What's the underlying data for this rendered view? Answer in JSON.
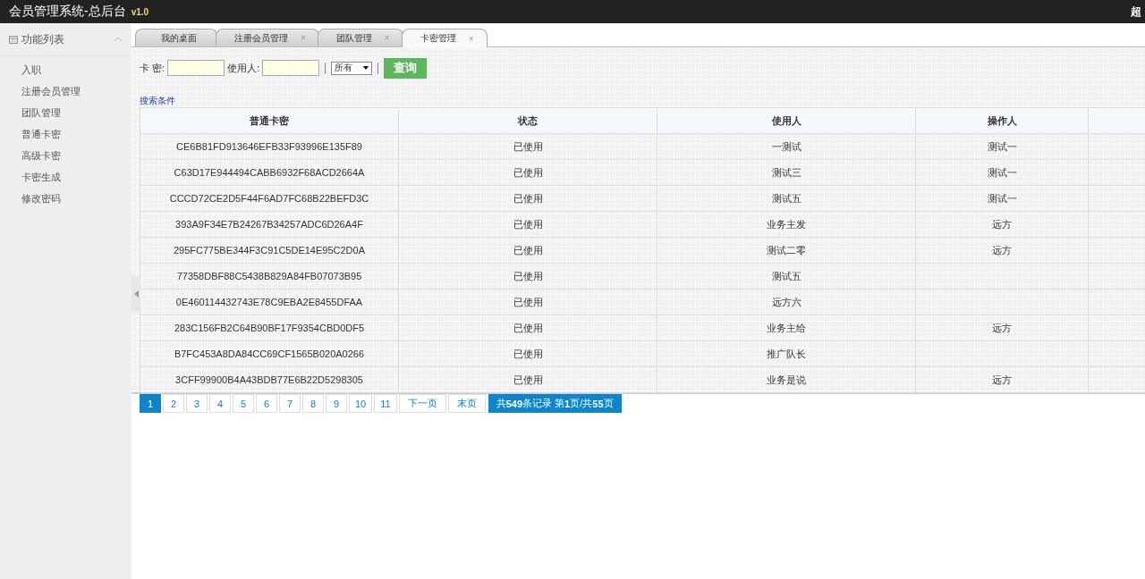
{
  "header": {
    "title": "会员管理系统-总后台",
    "version": "v1.0",
    "user": "超"
  },
  "sidebar": {
    "title": "功能列表",
    "expanded": true,
    "items": [
      {
        "label": "入职"
      },
      {
        "label": "注册会员管理"
      },
      {
        "label": "团队管理"
      },
      {
        "label": "普通卡密"
      },
      {
        "label": "高级卡密"
      },
      {
        "label": "卡密生成"
      },
      {
        "label": "修改密码"
      }
    ]
  },
  "tabs": [
    {
      "label": "我的桌面",
      "selected": false
    },
    {
      "label": "注册会员管理",
      "selected": false,
      "close": "×"
    },
    {
      "label": "团队管理",
      "selected": false,
      "close": "×"
    },
    {
      "label": "卡密管理",
      "selected": true,
      "close": "×"
    }
  ],
  "filters": {
    "card_label": "卡 密:",
    "user_label": "使用人:",
    "status_select": "所有",
    "query_button": "查询"
  },
  "search_conditions_link": "搜索条件",
  "table": {
    "columns": [
      "普通卡密",
      "状态",
      "使用人",
      "操作人"
    ],
    "rows": [
      [
        "CE6B81FD913646EFB33F93996E135F89",
        "已使用",
        "一测试",
        "测试一"
      ],
      [
        "C63D17E944494CABB6932F68ACD2664A",
        "已使用",
        "测试三",
        "测试一"
      ],
      [
        "CCCD72CE2D5F44F6AD7FC68B22BEFD3C",
        "已使用",
        "测试五",
        "测试一"
      ],
      [
        "393A9F34E7B24267B34257ADC6D26A4F",
        "已使用",
        "业务主发",
        "远方"
      ],
      [
        "295FC775BE344F3C91C5DE14E95C2D0A",
        "已使用",
        "测试二零",
        "远方"
      ],
      [
        "77358DBF88C5438B829A84FB07073B95",
        "已使用",
        "测试五",
        ""
      ],
      [
        "0E460114432743E78C9EBA2E8455DFAA",
        "已使用",
        "远方六",
        ""
      ],
      [
        "283C156FB2C64B90BF17F9354CBD0DF5",
        "已使用",
        "业务主给",
        "远方"
      ],
      [
        "B7FC453A8DA84CC69CF1565B020A0266",
        "已使用",
        "推广队长",
        ""
      ],
      [
        "3CFF99900B4A43BDB77E6B22D5298305",
        "已使用",
        "业务是说",
        "远方"
      ]
    ]
  },
  "pagination": {
    "pages": [
      {
        "label": "1",
        "selected": true
      },
      {
        "label": "2",
        "selected": false
      },
      {
        "label": "3",
        "selected": false
      },
      {
        "label": "4",
        "selected": false
      },
      {
        "label": "5",
        "selected": false
      },
      {
        "label": "6",
        "selected": false
      },
      {
        "label": "7",
        "selected": false
      },
      {
        "label": "8",
        "selected": false
      },
      {
        "label": "9",
        "selected": false
      },
      {
        "label": "10",
        "selected": false
      },
      {
        "label": "11",
        "selected": false
      }
    ],
    "next": "下一页",
    "last": "末页",
    "summary": "共**549**条记录 第**1**页/共**55**页"
  }
}
